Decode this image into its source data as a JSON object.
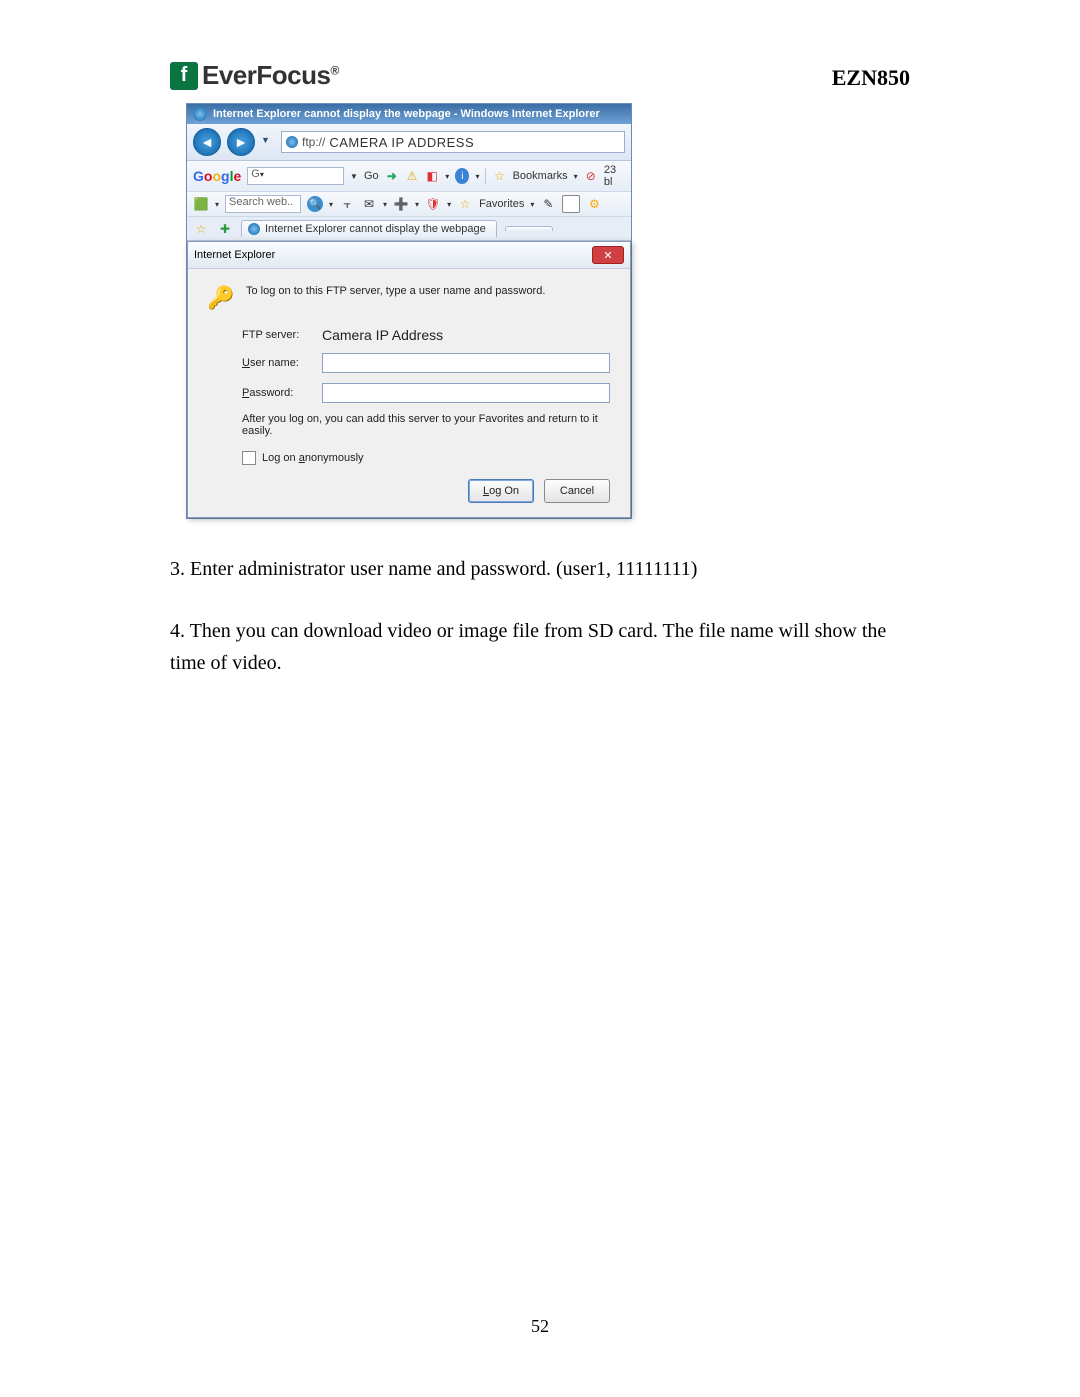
{
  "header": {
    "logo_text": "EverFocus",
    "logo_mark": "f",
    "model": "EZN850"
  },
  "browser": {
    "window_title": "Internet Explorer cannot display the webpage - Windows Internet Explorer",
    "address_protocol": "ftp://",
    "address_value": "CAMERA IP ADDRESS",
    "google_label": "Google",
    "google_search_prefix": "G",
    "go_label": "Go",
    "bookmarks_label": "Bookmarks",
    "bookmarks_count": "23 bl",
    "search_web_placeholder": "Search web..",
    "favorites_label": "Favorites",
    "tab_title": "Internet Explorer cannot display the webpage"
  },
  "dialog": {
    "title": "Internet Explorer",
    "instruction": "To log on to this FTP server, type a user name and password.",
    "ftp_server_label": "FTP server:",
    "ftp_server_value": "Camera IP Address",
    "username_label": "User name:",
    "password_label": "Password:",
    "note": "After you log on, you can add this server to your Favorites and return to it easily.",
    "anon_label": "Log on anonymously",
    "logon_button": "Log On",
    "cancel_button": "Cancel"
  },
  "body": {
    "step3": "3. Enter administrator user name and password. (user1, 11111111)",
    "step4": "4. Then you can download video or image file from SD card. The file name will show the time of video."
  },
  "page_number": "52"
}
